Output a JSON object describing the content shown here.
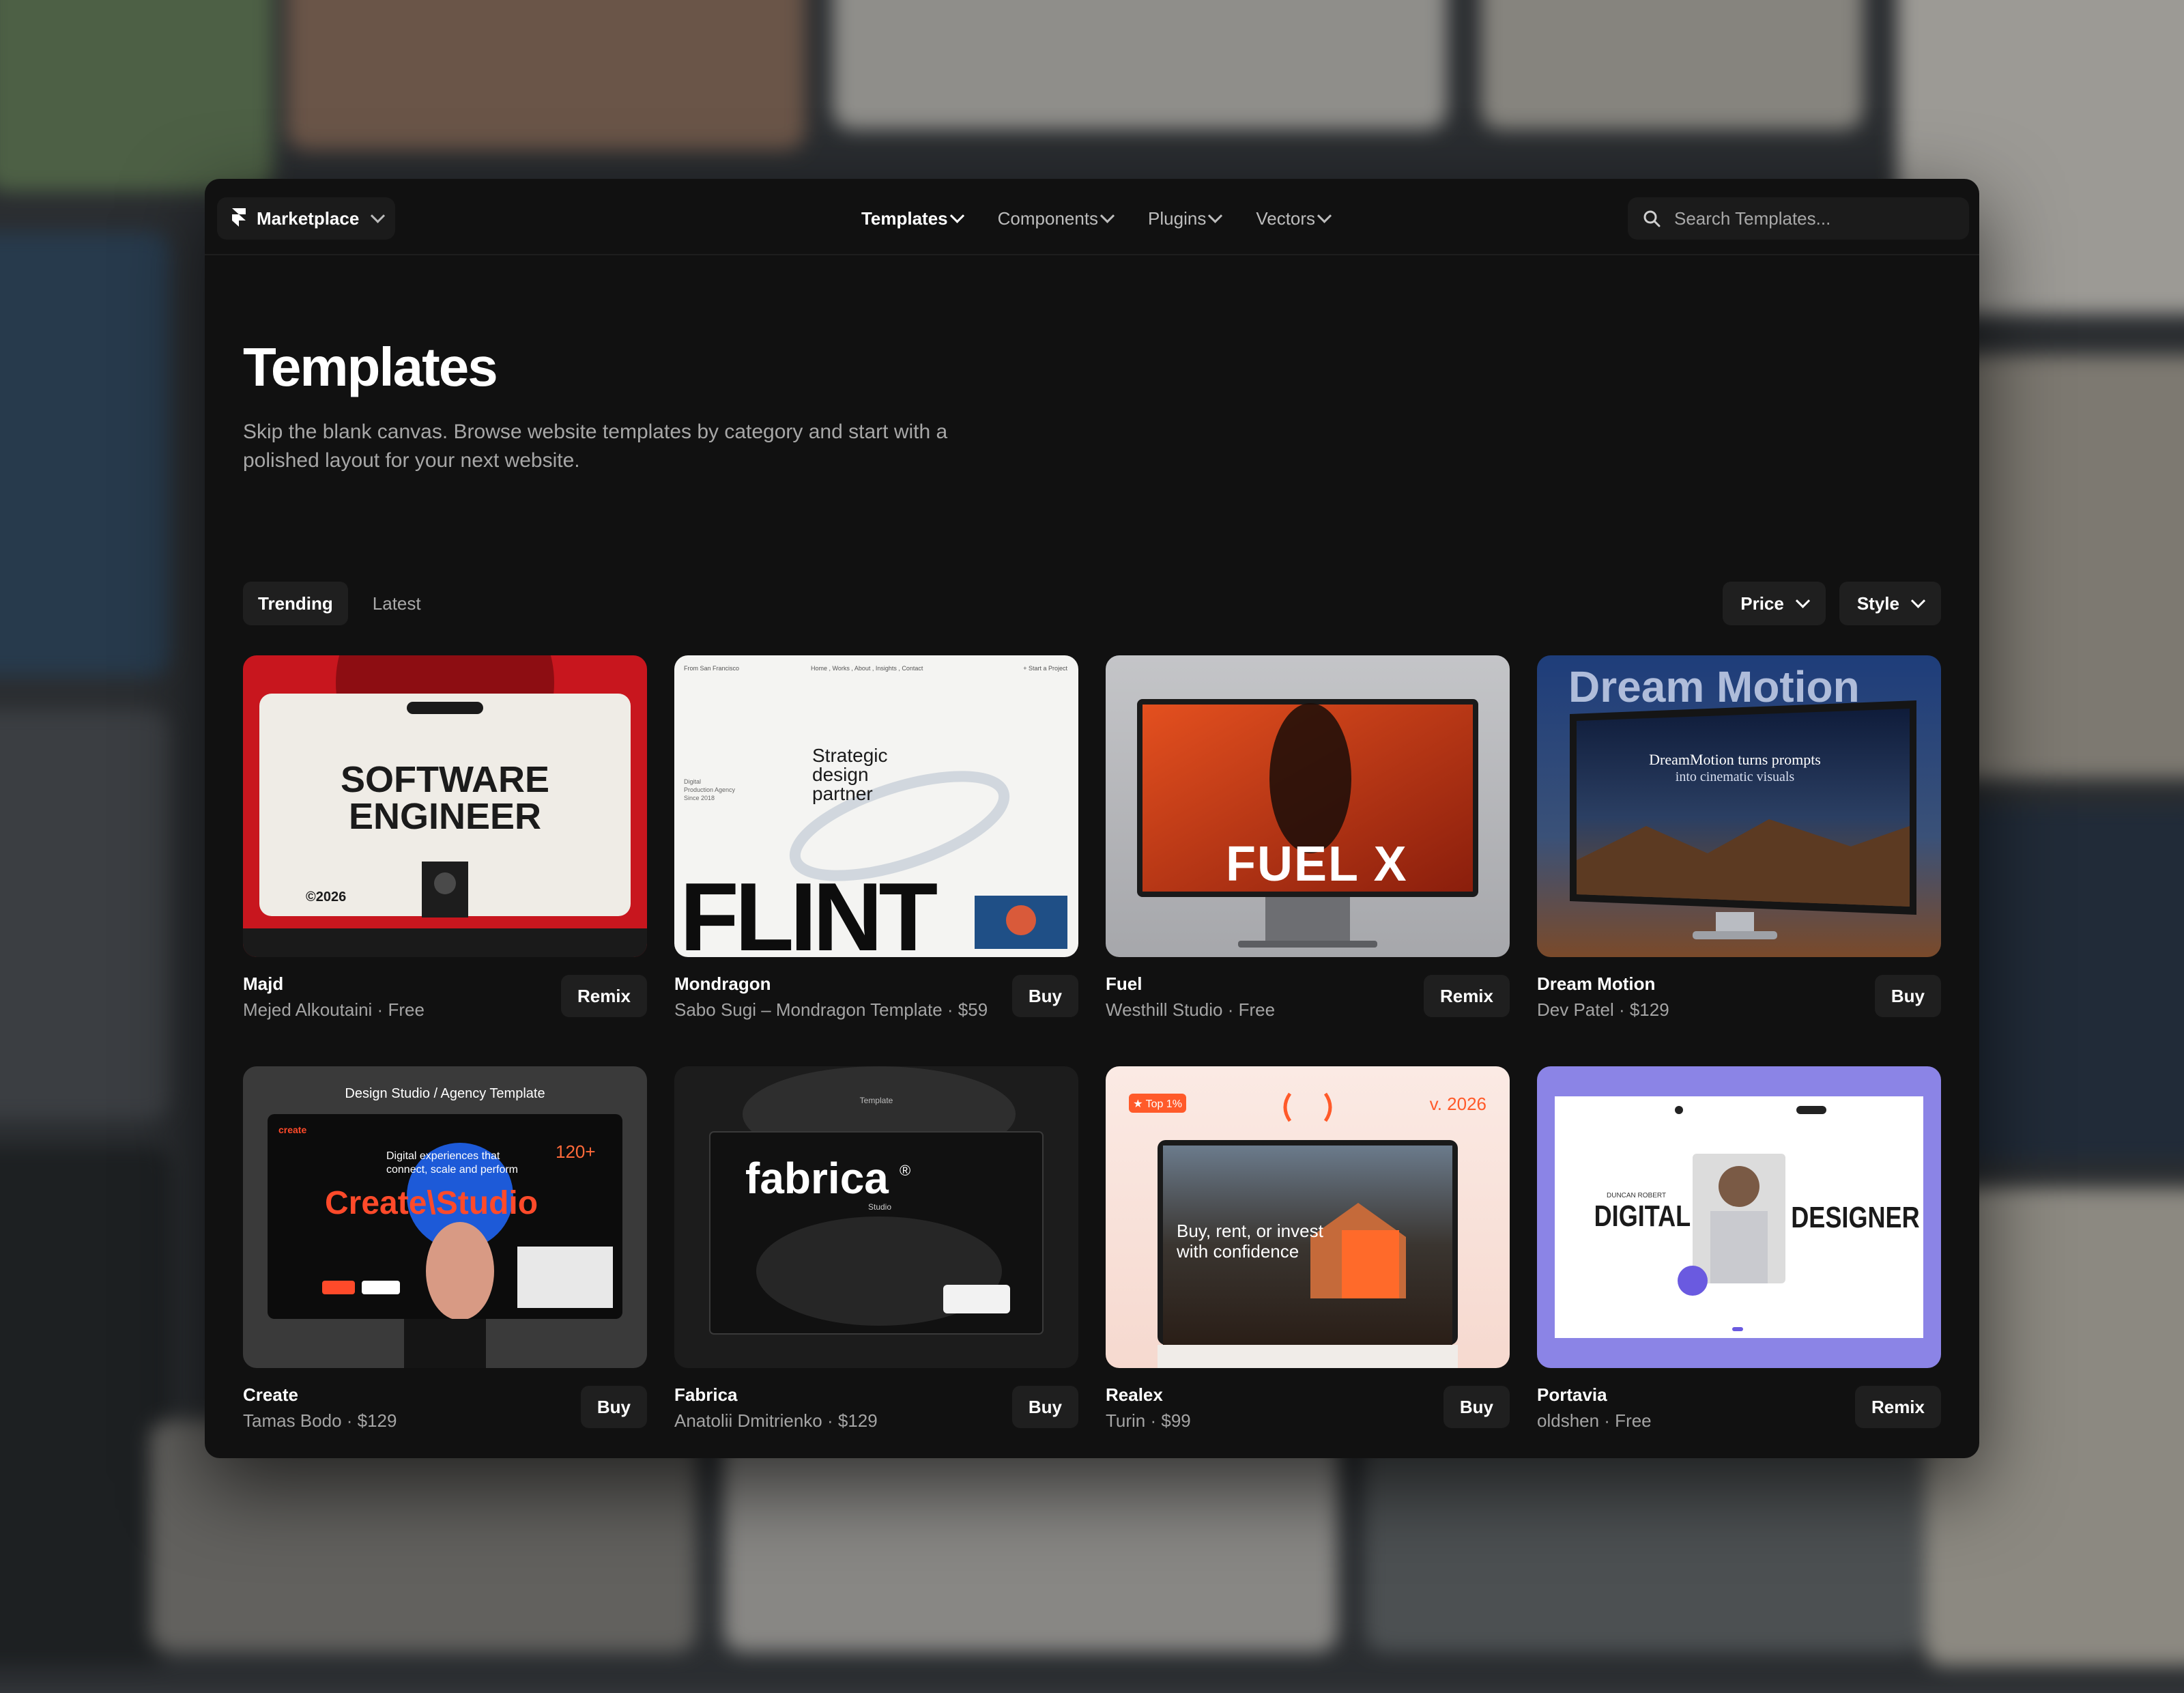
{
  "colors": {
    "window_bg": "#111111",
    "surface": "#1f1f1f",
    "text_primary": "#ffffff",
    "text_secondary": "#a4a4a4"
  },
  "topbar": {
    "brand": {
      "label": "Marketplace",
      "icon": "framer-logo-icon"
    },
    "nav": [
      {
        "label": "Templates",
        "active": true
      },
      {
        "label": "Components",
        "active": false
      },
      {
        "label": "Plugins",
        "active": false
      },
      {
        "label": "Vectors",
        "active": false
      }
    ],
    "search": {
      "placeholder": "Search Templates...",
      "value": ""
    }
  },
  "hero": {
    "title": "Templates",
    "subtitle": "Skip the blank canvas. Browse website templates by category and start with a polished layout for your next website."
  },
  "tabs": [
    {
      "label": "Trending",
      "active": true
    },
    {
      "label": "Latest",
      "active": false
    }
  ],
  "filters": [
    {
      "label": "Price"
    },
    {
      "label": "Style"
    }
  ],
  "templates": [
    {
      "name": "Majd",
      "meta": "Mejed Alkoutaini · Free",
      "action": "Remix",
      "thumb": {
        "headline_1": "SOFTWARE",
        "headline_2": "ENGINEER",
        "year": "©2026"
      }
    },
    {
      "name": "Mondragon",
      "meta": "Sabo Sugi – Mondragon Template · $59",
      "action": "Buy",
      "thumb": {
        "nav_left": "From San Francisco",
        "nav_center": "Home , Works , About , Insights , Contact",
        "nav_right": "+ Start a Project",
        "tag_1": "Digital",
        "tag_2": "Production Agency",
        "tag_3": "Since 2018",
        "tagline_1": "Strategic",
        "tagline_2": "design",
        "tagline_3": "partner",
        "logo": "FLINT"
      }
    },
    {
      "name": "Fuel",
      "meta": "Westhill Studio · Free",
      "action": "Remix",
      "thumb": {
        "logo": "FUEL X"
      }
    },
    {
      "name": "Dream Motion",
      "meta": "Dev Patel · $129",
      "action": "Buy",
      "thumb": {
        "title": "Dream Motion",
        "line_1": "DreamMotion turns prompts",
        "line_2": "into cinematic visuals"
      }
    },
    {
      "name": "Create",
      "meta": "Tamas Bodo · $129",
      "action": "Buy",
      "thumb": {
        "caption": "Design Studio / Agency Template",
        "brand": "create",
        "line_1": "Digital experiences that",
        "line_2": "connect, scale and perform",
        "stat": "120+",
        "logo": "Create\\Studio"
      }
    },
    {
      "name": "Fabrica",
      "meta": "Anatolii Dmitrienko · $129",
      "action": "Buy",
      "thumb": {
        "caption": "Template",
        "logo": "fabrica",
        "reg": "®",
        "sub": "Studio"
      }
    },
    {
      "name": "Realex",
      "meta": "Turin · $99",
      "action": "Buy",
      "thumb": {
        "badge": "★ Top 1%",
        "version": "v. 2026",
        "line_1": "Buy, rent, or invest",
        "line_2": "with confidence"
      }
    },
    {
      "name": "Portavia",
      "meta": "oldshen · Free",
      "action": "Remix",
      "thumb": {
        "word_1": "DIGITAL",
        "word_2": "DESIGNER",
        "small": "DUNCAN ROBERT"
      }
    }
  ]
}
